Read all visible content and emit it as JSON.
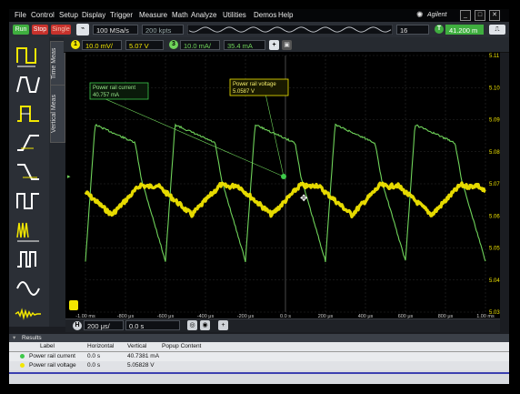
{
  "menu": [
    "File",
    "Control",
    "Setup",
    "Display",
    "Trigger",
    "Measure",
    "Math",
    "Analyze",
    "Utilities",
    "Demos",
    "Help"
  ],
  "brand": "Agilent",
  "toolbar": {
    "run_label": "Run",
    "stop_label": "Stop",
    "single_label": "Single",
    "sample_rate": "100 MSa/s",
    "memory_depth": "200 kpts",
    "averaging": "16",
    "trigger_level": "41.200 m",
    "ch1_scale": "10.0 mV/",
    "ch1_offset": "5.07 V",
    "ch3_scale": "10.0 mA/",
    "ch3_offset": "35.4 mA",
    "ch1_badge": "1",
    "ch3_badge": "3",
    "trigger_badge": "T"
  },
  "side_tabs": {
    "time_meas": "Time Meas",
    "vertical_meas": "Vertical Meas"
  },
  "markers": {
    "current": {
      "title": "Power rail current",
      "value": "40.757 mA"
    },
    "voltage": {
      "title": "Power rail voltage",
      "value": "5.0587 V"
    }
  },
  "axes": {
    "y_right": [
      "5.11 V",
      "5.10 V",
      "5.09 V",
      "5.08 V",
      "5.07 V",
      "5.06 V",
      "5.05 V",
      "5.04 V",
      "5.03 V"
    ],
    "x_bottom": [
      "-1.00 ms",
      "-800 μs",
      "-600 μs",
      "-400 μs",
      "-200 μs",
      "0.0 s",
      "200 μs",
      "400 μs",
      "600 μs",
      "800 μs",
      "1.00 ms"
    ]
  },
  "timebase": {
    "scale": "200 μs/",
    "delay": "0.0 s",
    "h_badge": "H"
  },
  "results": {
    "title": "Results",
    "columns": [
      "Label",
      "Horizontal",
      "Vertical",
      "Popup Content"
    ],
    "rows": [
      {
        "label": "Power rail current",
        "horizontal": "0.0 s",
        "vertical": "40.7381 mA",
        "color": "#3ec94a"
      },
      {
        "label": "Power rail voltage",
        "horizontal": "0.0 s",
        "vertical": "5.05828 V",
        "color": "#f2e600"
      }
    ]
  },
  "colors": {
    "ch1": "#f2e600",
    "ch3": "#6fd35a",
    "run": "#3fae3f",
    "stop": "#c8322c"
  }
}
